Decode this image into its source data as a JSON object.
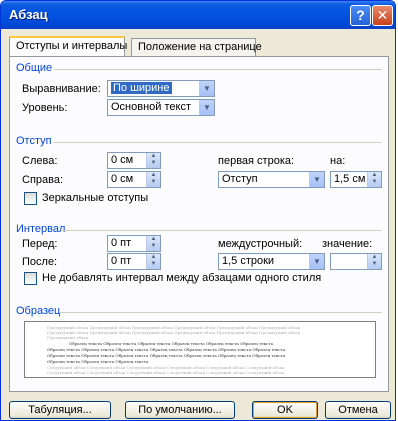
{
  "window": {
    "title": "Абзац"
  },
  "titlebar_buttons": {
    "help": "?",
    "close": "✕"
  },
  "tabs": [
    {
      "label": "Отступы и интервалы",
      "active": true
    },
    {
      "label": "Положение на странице",
      "active": false
    }
  ],
  "general": {
    "group": "Общие",
    "alignment_label": "Выравнивание:",
    "alignment_value": "По ширине",
    "level_label": "Уровень:",
    "level_value": "Основной текст"
  },
  "indent": {
    "group": "Отступ",
    "left_label": "Слева:",
    "left_value": "0 см",
    "right_label": "Справа:",
    "right_value": "0 см",
    "first_line_label": "первая строка:",
    "first_line_value": "Отступ",
    "by_label": "на:",
    "by_value": "1,5 см",
    "mirror_label": "Зеркальные отступы",
    "mirror_checked": false
  },
  "spacing": {
    "group": "Интервал",
    "before_label": "Перед:",
    "before_value": "0 пт",
    "after_label": "После:",
    "after_value": "0 пт",
    "line_label": "междустрочный:",
    "line_value": "1,5 строки",
    "at_label": "значение:",
    "at_value": "",
    "no_space_label": "Не добавлять интервал между абзацами одного стиля",
    "no_space_checked": false
  },
  "preview": {
    "group": "Образец",
    "prev_lines": [
      "Предыдущий абзац Предыдущий абзац Предыдущий абзац Предыдущий абзац Предыдущий абзац Предыдущий абзац",
      "Предыдущий абзац Предыдущий абзац Предыдущий абзац Предыдущий абзац Предыдущий абзац Предыдущий абзац",
      "Предыдущий абзац"
    ],
    "sample_lines": [
      "Образец текста Образец текста Образец текста Образец текста Образец текста Образец текста",
      "Образец текста Образец текста Образец текста Образец текста Образец текста Образец текста Образец текста",
      "Образец текста Образец текста Образец текста Образец текста Образец текста Образец текста Образец текста",
      "Образец текста Образец текста Образец текста"
    ],
    "next_lines": [
      "Следующий абзац Следующий абзац Следующий абзац Следующий абзац Следующий абзац Следующий абзац",
      "Следующий абзац Следующий абзац Следующий абзац Следующий абзац Следующий абзац Следующий абзац"
    ]
  },
  "buttons": {
    "tabs": "Табуляция...",
    "default": "По умолчанию...",
    "ok": "OK",
    "cancel": "Отмена"
  },
  "colors": {
    "titlebar": "#0352e0",
    "group_label": "#0046d5",
    "selection": "#316ac5",
    "dialog_bg": "#ece9d8"
  },
  "icons": {
    "help": "help-icon",
    "close": "close-icon",
    "dropdown": "chevron-down-icon",
    "spinner": "spinner-arrows-icon"
  }
}
